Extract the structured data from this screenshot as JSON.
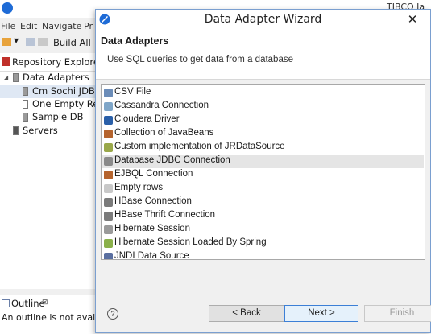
{
  "ide": {
    "brand_partial": "TIBCO Ja",
    "menu": [
      "File",
      "Edit",
      "Navigate",
      "Pr"
    ],
    "toolbar": {
      "build_all": "Build All"
    },
    "repository_tab": "Repository Explorer",
    "tree": [
      {
        "label": "Data Adapters",
        "level": 0,
        "expanded": true
      },
      {
        "label": "Cm Sochi JDBC",
        "level": 1,
        "selected": true
      },
      {
        "label": "One Empty Rec",
        "level": 1
      },
      {
        "label": "Sample DB",
        "level": 1
      },
      {
        "label": "Servers",
        "level": 0
      }
    ],
    "outline": {
      "tab": "Outline",
      "close": "⊠",
      "message": "An outline is not availab"
    }
  },
  "dialog": {
    "title": "Data Adapter Wizard",
    "close_glyph": "✕",
    "banner_title": "Data Adapters",
    "banner_description": "Use SQL queries to get data from a database",
    "adapters": [
      {
        "label": "CSV File",
        "icon": "csv-file-icon",
        "color": "#6b8cb8"
      },
      {
        "label": "Cassandra Connection",
        "icon": "cassandra-icon",
        "color": "#7fa6c8"
      },
      {
        "label": "Cloudera Driver",
        "icon": "cloudera-icon",
        "color": "#2a5fa8"
      },
      {
        "label": "Collection of JavaBeans",
        "icon": "javabeans-icon",
        "color": "#b5642e"
      },
      {
        "label": "Custom implementation of JRDataSource",
        "icon": "custom-datasource-icon",
        "color": "#9aa84a"
      },
      {
        "label": "Database JDBC Connection",
        "icon": "database-icon",
        "color": "#8a8a8a",
        "selected": true
      },
      {
        "label": "EJBQL Connection",
        "icon": "ejbql-icon",
        "color": "#b5642e"
      },
      {
        "label": "Empty rows",
        "icon": "empty-rows-icon",
        "color": "#c8c8c8"
      },
      {
        "label": "HBase Connection",
        "icon": "hbase-icon",
        "color": "#7a7a7a"
      },
      {
        "label": "HBase Thrift Connection",
        "icon": "hbase-thrift-icon",
        "color": "#7a7a7a"
      },
      {
        "label": "Hibernate Session",
        "icon": "hibernate-icon",
        "color": "#9a9a9a"
      },
      {
        "label": "Hibernate Session Loaded By Spring",
        "icon": "hibernate-spring-icon",
        "color": "#8ab04a"
      },
      {
        "label": "JNDI Data Source",
        "icon": "jndi-icon",
        "color": "#5a6fa0"
      }
    ],
    "buttons": {
      "help": "?",
      "back": "< Back",
      "next": "Next >",
      "finish": "Finish"
    }
  }
}
